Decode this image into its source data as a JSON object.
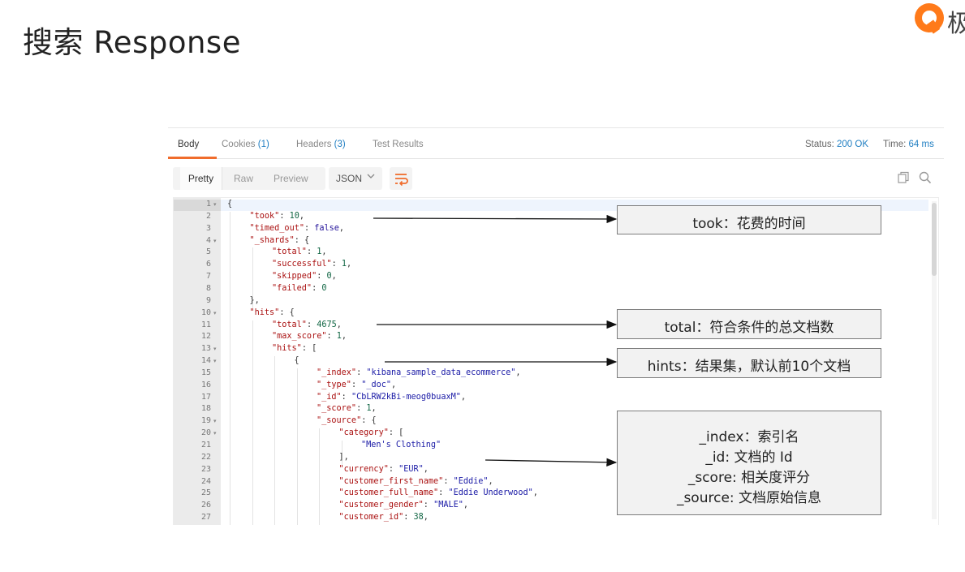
{
  "slide": {
    "title": "搜索 Response",
    "logo_char": "极"
  },
  "tabs": [
    {
      "label": "Body"
    },
    {
      "label": "Cookies",
      "count": "(1)"
    },
    {
      "label": "Headers",
      "count": "(3)"
    },
    {
      "label": "Test Results"
    }
  ],
  "status": {
    "status_label": "Status:",
    "status_value": "200 OK",
    "time_label": "Time:",
    "time_value": "64 ms"
  },
  "view_modes": [
    "Pretty",
    "Raw",
    "Preview"
  ],
  "format": {
    "selected": "JSON"
  },
  "icons": {
    "wrap": "wrap-lines-icon",
    "copy": "copy-icon",
    "search": "search-icon"
  },
  "colors": {
    "accent": "#f06c2c",
    "link": "#1f7ec2"
  },
  "code_lines": [
    {
      "n": "1",
      "fold": true,
      "indent": 0,
      "parts": [
        [
          "p",
          "{"
        ]
      ]
    },
    {
      "n": "2",
      "fold": false,
      "indent": 1,
      "parts": [
        [
          "k",
          "\"took\""
        ],
        [
          "p",
          ": "
        ],
        [
          "n",
          "10"
        ],
        [
          "p",
          ","
        ]
      ]
    },
    {
      "n": "3",
      "fold": false,
      "indent": 1,
      "parts": [
        [
          "k",
          "\"timed_out\""
        ],
        [
          "p",
          ": "
        ],
        [
          "b",
          "false"
        ],
        [
          "p",
          ","
        ]
      ]
    },
    {
      "n": "4",
      "fold": true,
      "indent": 1,
      "parts": [
        [
          "k",
          "\"_shards\""
        ],
        [
          "p",
          ": {"
        ]
      ]
    },
    {
      "n": "5",
      "fold": false,
      "indent": 2,
      "parts": [
        [
          "k",
          "\"total\""
        ],
        [
          "p",
          ": "
        ],
        [
          "n",
          "1"
        ],
        [
          "p",
          ","
        ]
      ]
    },
    {
      "n": "6",
      "fold": false,
      "indent": 2,
      "parts": [
        [
          "k",
          "\"successful\""
        ],
        [
          "p",
          ": "
        ],
        [
          "n",
          "1"
        ],
        [
          "p",
          ","
        ]
      ]
    },
    {
      "n": "7",
      "fold": false,
      "indent": 2,
      "parts": [
        [
          "k",
          "\"skipped\""
        ],
        [
          "p",
          ": "
        ],
        [
          "n",
          "0"
        ],
        [
          "p",
          ","
        ]
      ]
    },
    {
      "n": "8",
      "fold": false,
      "indent": 2,
      "parts": [
        [
          "k",
          "\"failed\""
        ],
        [
          "p",
          ": "
        ],
        [
          "n",
          "0"
        ]
      ]
    },
    {
      "n": "9",
      "fold": false,
      "indent": 1,
      "parts": [
        [
          "p",
          "},"
        ]
      ]
    },
    {
      "n": "10",
      "fold": true,
      "indent": 1,
      "parts": [
        [
          "k",
          "\"hits\""
        ],
        [
          "p",
          ": {"
        ]
      ]
    },
    {
      "n": "11",
      "fold": false,
      "indent": 2,
      "parts": [
        [
          "k",
          "\"total\""
        ],
        [
          "p",
          ": "
        ],
        [
          "n",
          "4675"
        ],
        [
          "p",
          ","
        ]
      ]
    },
    {
      "n": "12",
      "fold": false,
      "indent": 2,
      "parts": [
        [
          "k",
          "\"max_score\""
        ],
        [
          "p",
          ": "
        ],
        [
          "n",
          "1"
        ],
        [
          "p",
          ","
        ]
      ]
    },
    {
      "n": "13",
      "fold": true,
      "indent": 2,
      "parts": [
        [
          "k",
          "\"hits\""
        ],
        [
          "p",
          ": ["
        ]
      ]
    },
    {
      "n": "14",
      "fold": true,
      "indent": 3,
      "parts": [
        [
          "p",
          "{"
        ]
      ]
    },
    {
      "n": "15",
      "fold": false,
      "indent": 4,
      "parts": [
        [
          "k",
          "\"_index\""
        ],
        [
          "p",
          ": "
        ],
        [
          "s",
          "\"kibana_sample_data_ecommerce\""
        ],
        [
          "p",
          ","
        ]
      ]
    },
    {
      "n": "16",
      "fold": false,
      "indent": 4,
      "parts": [
        [
          "k",
          "\"_type\""
        ],
        [
          "p",
          ": "
        ],
        [
          "s",
          "\"_doc\""
        ],
        [
          "p",
          ","
        ]
      ]
    },
    {
      "n": "17",
      "fold": false,
      "indent": 4,
      "parts": [
        [
          "k",
          "\"_id\""
        ],
        [
          "p",
          ": "
        ],
        [
          "s",
          "\"CbLRW2kBi-meog0buaxM\""
        ],
        [
          "p",
          ","
        ]
      ]
    },
    {
      "n": "18",
      "fold": false,
      "indent": 4,
      "parts": [
        [
          "k",
          "\"_score\""
        ],
        [
          "p",
          ": "
        ],
        [
          "n",
          "1"
        ],
        [
          "p",
          ","
        ]
      ]
    },
    {
      "n": "19",
      "fold": true,
      "indent": 4,
      "parts": [
        [
          "k",
          "\"_source\""
        ],
        [
          "p",
          ": {"
        ]
      ]
    },
    {
      "n": "20",
      "fold": true,
      "indent": 5,
      "parts": [
        [
          "k",
          "\"category\""
        ],
        [
          "p",
          ": ["
        ]
      ]
    },
    {
      "n": "21",
      "fold": false,
      "indent": 6,
      "parts": [
        [
          "s",
          "\"Men's Clothing\""
        ]
      ]
    },
    {
      "n": "22",
      "fold": false,
      "indent": 5,
      "parts": [
        [
          "p",
          "],"
        ]
      ]
    },
    {
      "n": "23",
      "fold": false,
      "indent": 5,
      "parts": [
        [
          "k",
          "\"currency\""
        ],
        [
          "p",
          ": "
        ],
        [
          "s",
          "\"EUR\""
        ],
        [
          "p",
          ","
        ]
      ]
    },
    {
      "n": "24",
      "fold": false,
      "indent": 5,
      "parts": [
        [
          "k",
          "\"customer_first_name\""
        ],
        [
          "p",
          ": "
        ],
        [
          "s",
          "\"Eddie\""
        ],
        [
          "p",
          ","
        ]
      ]
    },
    {
      "n": "25",
      "fold": false,
      "indent": 5,
      "parts": [
        [
          "k",
          "\"customer_full_name\""
        ],
        [
          "p",
          ": "
        ],
        [
          "s",
          "\"Eddie Underwood\""
        ],
        [
          "p",
          ","
        ]
      ]
    },
    {
      "n": "26",
      "fold": false,
      "indent": 5,
      "parts": [
        [
          "k",
          "\"customer_gender\""
        ],
        [
          "p",
          ": "
        ],
        [
          "s",
          "\"MALE\""
        ],
        [
          "p",
          ","
        ]
      ]
    },
    {
      "n": "27",
      "fold": false,
      "indent": 5,
      "parts": [
        [
          "k",
          "\"customer_id\""
        ],
        [
          "p",
          ": "
        ],
        [
          "n",
          "38"
        ],
        [
          "p",
          ","
        ]
      ]
    }
  ],
  "annotations": [
    {
      "lines": [
        "took：花费的时间"
      ]
    },
    {
      "lines": [
        "total：符合条件的总文档数"
      ]
    },
    {
      "lines": [
        "hints：结果集，默认前10个文档"
      ]
    },
    {
      "lines": [
        "_index：索引名",
        "_id: 文档的 Id",
        "_score: 相关度评分",
        "_source: 文档原始信息"
      ]
    }
  ]
}
